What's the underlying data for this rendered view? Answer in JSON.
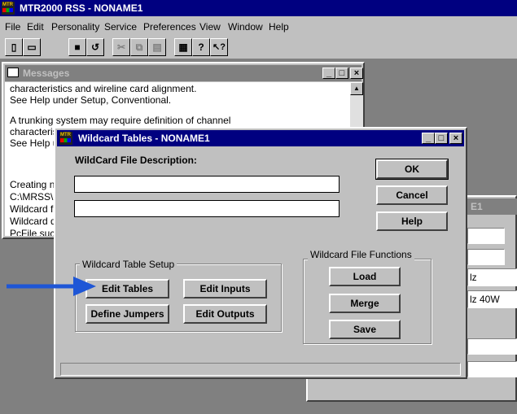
{
  "app": {
    "title": "MTR2000 RSS - NONAME1",
    "logo_text": "MTR"
  },
  "menu": [
    "File",
    "Edit",
    "Personality",
    "Service",
    "Preferences",
    "View",
    "Window",
    "Help"
  ],
  "toolbar": {
    "icons": [
      "new-icon",
      "open-icon",
      "save-icon",
      "save-as-icon",
      "cut-icon",
      "copy-icon",
      "paste-icon",
      "print-icon",
      "help-icon",
      "context-help-icon"
    ],
    "glyphs": [
      "▯",
      "▭",
      "■",
      "↺",
      "✂",
      "⧉",
      "▤",
      "▦",
      "?",
      "↖?"
    ]
  },
  "messages": {
    "title": "Messages",
    "lines": [
      "characteristics and wireline card alignment.",
      "See Help under Setup, Conventional.",
      "",
      "A trunking system may require definition of channel",
      "characteristics",
      "See Help u",
      "",
      "",
      "",
      "Creating n",
      "C:\\MRSS\\",
      "Wildcard fi",
      "Wildcard d",
      "PcFile suc"
    ]
  },
  "background_window": {
    "title_fragment": "E1",
    "field_values": [
      "",
      "",
      "lz",
      "lz 40W",
      "",
      ""
    ]
  },
  "dialog": {
    "title": "Wildcard Tables - NONAME1",
    "description_label": "WildCard File Description:",
    "description_line1": "",
    "description_line2": "",
    "ok_label": "OK",
    "cancel_label": "Cancel",
    "help_label": "Help",
    "setup_group_label": "Wildcard Table Setup",
    "edit_tables_label": "Edit Tables",
    "edit_inputs_label": "Edit Inputs",
    "define_jumpers_label": "Define Jumpers",
    "edit_outputs_label": "Edit Outputs",
    "functions_group_label": "Wildcard File Functions",
    "load_label": "Load",
    "merge_label": "Merge",
    "save_label": "Save",
    "status_text": ""
  },
  "annotation": {
    "arrow_color": "#1e56d6"
  },
  "colors": {
    "title_active": "#000080",
    "title_inactive": "#808080",
    "face": "#c0c0c0",
    "desktop": "#808080"
  }
}
